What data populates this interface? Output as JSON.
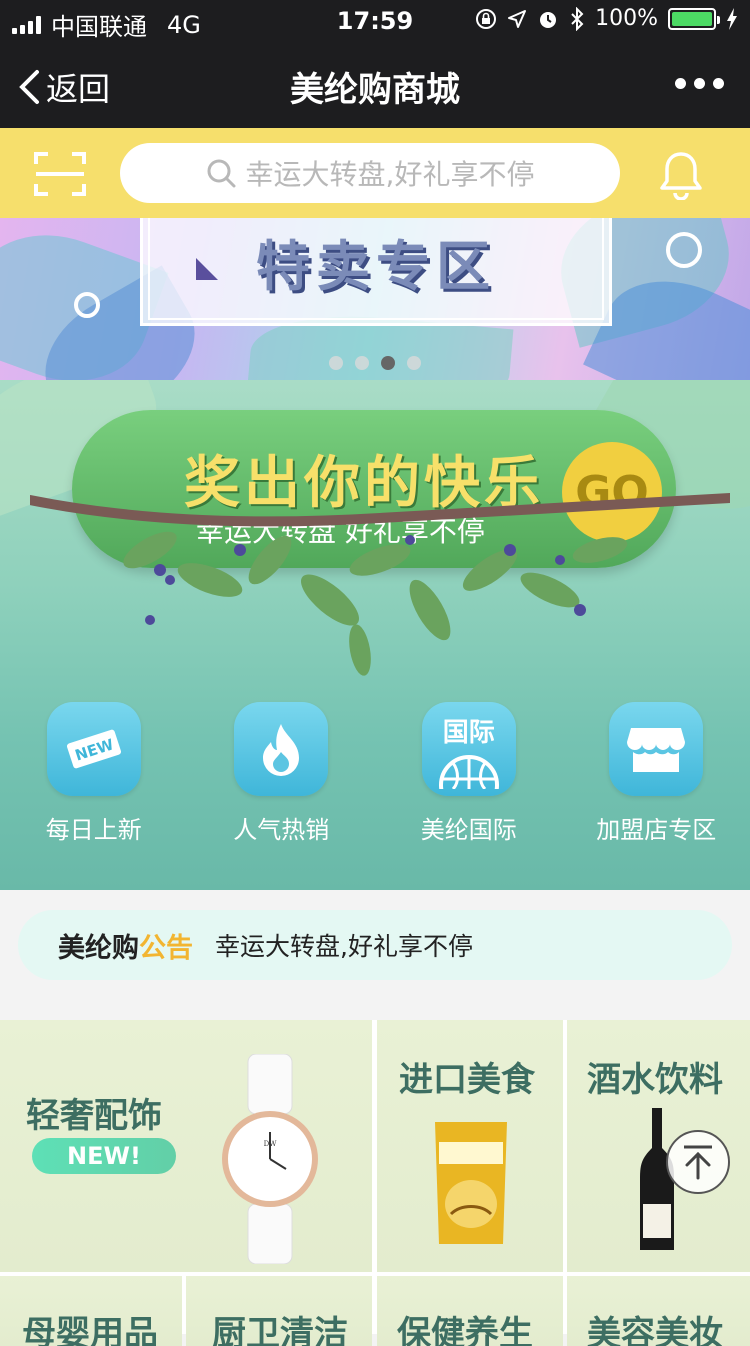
{
  "status": {
    "carrier": "中国联通",
    "network": "4G",
    "time": "17:59",
    "battery": "100%"
  },
  "nav": {
    "back": "返回",
    "title": "美纶购商城"
  },
  "search": {
    "placeholder": "幸运大转盘,好礼享不停"
  },
  "banner": {
    "title": "特卖专区",
    "slides": 4,
    "active_slide": 3
  },
  "hero": {
    "title": "奖出你的快乐",
    "subtitle": "幸运大转盘 好礼享不停",
    "go": "GO"
  },
  "shortcuts": [
    {
      "label": "每日上新",
      "icon": "new-tag-icon",
      "badge": "NEW"
    },
    {
      "label": "人气热销",
      "icon": "flame-icon"
    },
    {
      "label": "美纶国际",
      "icon": "globe-icon",
      "badge": "国际"
    },
    {
      "label": "加盟店专区",
      "icon": "store-icon"
    }
  ],
  "notice": {
    "brand": "美纶购",
    "tag": "公告",
    "text": "幸运大转盘,好礼享不停"
  },
  "categories": [
    {
      "label": "轻奢配饰",
      "tag": "NEW!"
    },
    {
      "label": "进口美食"
    },
    {
      "label": "酒水饮料"
    },
    {
      "label": "母婴用品"
    },
    {
      "label": "厨卫清洁"
    },
    {
      "label": "保健养生"
    },
    {
      "label": "美容美妆"
    }
  ],
  "colors": {
    "accent": "#f6df6c",
    "navbar": "#1d1d1f",
    "shortcut_icon": "#3fb6d9",
    "notice_tag": "#f2b531"
  }
}
